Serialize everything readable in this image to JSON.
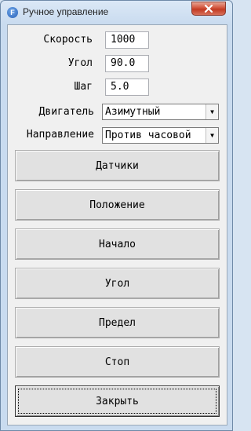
{
  "window": {
    "title": "Ручное управление",
    "app_icon_letter": "F"
  },
  "form": {
    "speed": {
      "label": "Скорость",
      "value": "1000"
    },
    "angle": {
      "label": "Угол",
      "value": "90.0"
    },
    "step": {
      "label": "Шаг",
      "value": "5.0"
    },
    "engine": {
      "label": "Двигатель",
      "selected": "Азимутный"
    },
    "direction": {
      "label": "Направление",
      "selected": "Против часовой"
    }
  },
  "buttons": {
    "sensors": "Датчики",
    "position": "Положение",
    "start": "Начало",
    "angle": "Угол",
    "limit": "Предел",
    "stop": "Стоп",
    "close": "Закрыть"
  }
}
